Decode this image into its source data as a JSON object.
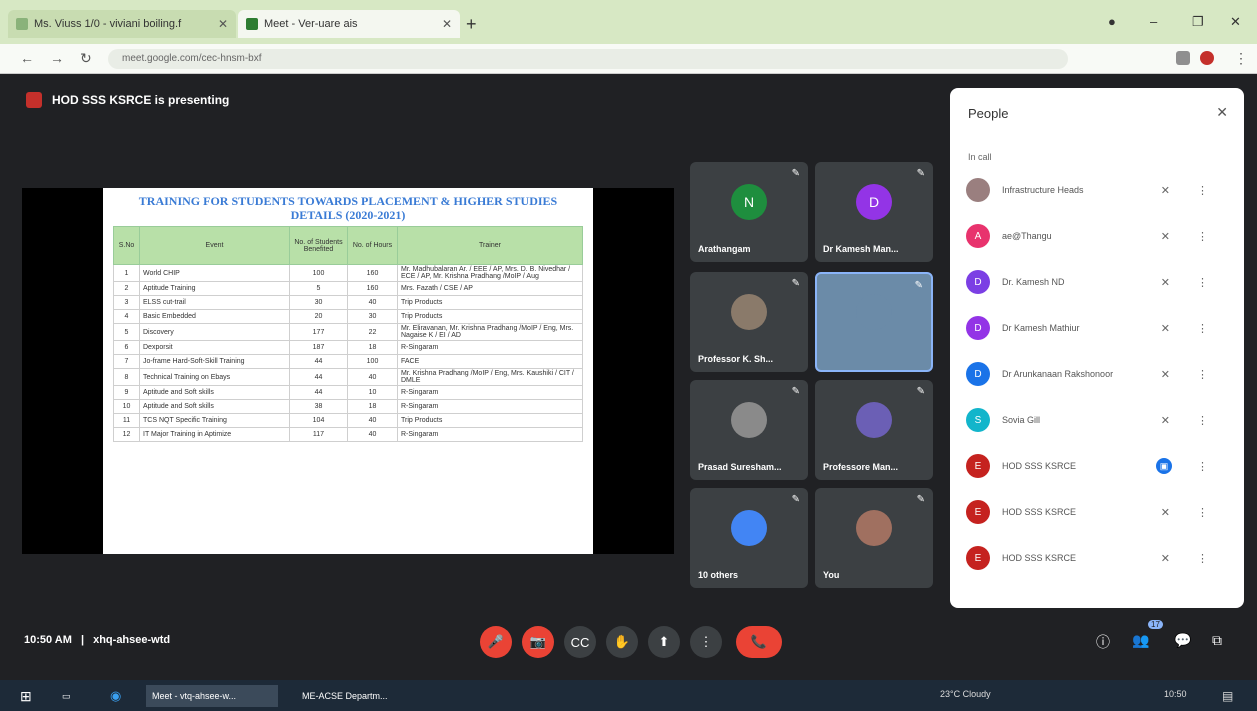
{
  "browser": {
    "tabs": [
      {
        "label": "Ms. Viuss 1/0 - viviani boiling.f"
      },
      {
        "label": "Meet - Ver-uare ais"
      }
    ],
    "new_tab": "+",
    "url": "meet.google.com/cec-hnsm-bxf",
    "window_controls": {
      "minimize": "–",
      "maximize": "❐",
      "close": "✕"
    }
  },
  "meet": {
    "presenting_text": "HOD SSS KSRCE is presenting",
    "slide": {
      "title": "TRAINING FOR STUDENTS TOWARDS PLACEMENT & HIGHER STUDIES DETAILS (2020-2021)",
      "headers": [
        "S.No",
        "Event",
        "No. of Students Benefited",
        "No. of Hours",
        "Trainer"
      ],
      "rows": [
        [
          "1",
          "World CHIP",
          "100",
          "160",
          "Mr. Madhubalaran Ar. / EEE / AP, Mrs. D. B. Nivedhar / ECE / AP, Mr. Krishna Pradhang /MoIP / Aug"
        ],
        [
          "2",
          "Aptitude Training",
          "5",
          "160",
          "Mrs. Fazath / CSE / AP"
        ],
        [
          "3",
          "ELSS cut-trail",
          "30",
          "40",
          "Trip Products"
        ],
        [
          "4",
          "Basic Embedded",
          "20",
          "30",
          "Trip Products"
        ],
        [
          "5",
          "Discovery",
          "177",
          "22",
          "Mr. Eliravanan, Mr. Krishna Pradhang /MoIP / Eng, Mrs. Nagaise K / EI / AD"
        ],
        [
          "6",
          "Dexporsit",
          "187",
          "18",
          "R-Singaram"
        ],
        [
          "7",
          "Jo-frame Hard-Soft-Skill Training",
          "44",
          "100",
          "FACE"
        ],
        [
          "8",
          "Technical Training on Ebays",
          "44",
          "40",
          "Mr. Krishna Pradhang /MoIP / Eng, Mrs. Kaushiki / CIT / DMLE"
        ],
        [
          "9",
          "Aptitude and Soft skills",
          "44",
          "10",
          "R-Singaram"
        ],
        [
          "10",
          "Aptitude and Soft skills",
          "38",
          "18",
          "R-Singaram"
        ],
        [
          "11",
          "TCS NQT Specific Training",
          "104",
          "40",
          "Trip Products"
        ],
        [
          "12",
          "IT Major Training in Aptimize",
          "117",
          "40",
          "R-Singaram"
        ]
      ]
    },
    "tiles": [
      {
        "name": "Arathangam",
        "initial": "N",
        "color": "#1e8e3e"
      },
      {
        "name": "Dr Kamesh Man...",
        "initial": "D",
        "color": "#9334e6"
      },
      {
        "name": "Professor K. Sh...",
        "initial": "",
        "color": "#8a7a6a"
      },
      {
        "name": "",
        "initial": "",
        "color": "#6b8ba8"
      },
      {
        "name": "Prasad Suresham...",
        "initial": "",
        "color": "#8a8a8a"
      },
      {
        "name": "Professore Man...",
        "initial": "",
        "color": "#6b5fb5"
      },
      {
        "name": "10 others",
        "initial": "",
        "color": "#4285f4"
      },
      {
        "name": "You",
        "initial": "",
        "color": "#a07060"
      }
    ]
  },
  "people_panel": {
    "title": "People",
    "section": "In call",
    "people": [
      {
        "name": "Infrastructure Heads",
        "initial": "",
        "color": "#9a7f7f"
      },
      {
        "name": "ae@Thangu",
        "initial": "A",
        "color": "#e8336d"
      },
      {
        "name": "Dr. Kamesh ND",
        "initial": "D",
        "color": "#7b3fe4"
      },
      {
        "name": "Dr Kamesh Mathiur",
        "initial": "D",
        "color": "#9334e6"
      },
      {
        "name": "Dr Arunkanaan Rakshonoor",
        "initial": "D",
        "color": "#1a73e8"
      },
      {
        "name": "Sovia Gill",
        "initial": "S",
        "color": "#12b5cb"
      },
      {
        "name": "HOD SSS KSRCE",
        "initial": "E",
        "color": "#c5221f"
      },
      {
        "name": "HOD SSS KSRCE",
        "initial": "E",
        "color": "#c5221f"
      },
      {
        "name": "HOD SSS KSRCE",
        "initial": "E",
        "color": "#c5221f"
      }
    ]
  },
  "bottom_bar": {
    "time": "10:50 AM",
    "meeting_code": "xhq-ahsee-wtd",
    "controls": {
      "mic": "🎤",
      "camera": "📷",
      "captions": "CC",
      "hand": "✋",
      "present": "⬆",
      "more": "⋮",
      "end": "📞"
    },
    "right": {
      "info": "ⓘ",
      "people": "👥",
      "chat": "💬",
      "activities": "⧉"
    },
    "people_count": "17"
  },
  "taskbar": {
    "apps": [
      {
        "label": "Meet - vtq-ahsee-w..."
      },
      {
        "label": "ME-ACSE Departm..."
      }
    ],
    "weather": "23°C  Cloudy",
    "clock": "10:50"
  }
}
